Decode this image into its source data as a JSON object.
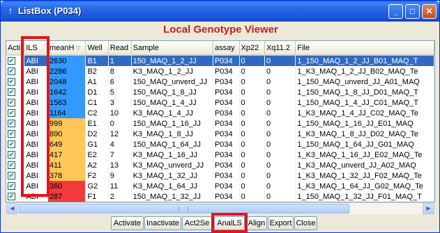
{
  "window": {
    "title": "ListBox (P034)",
    "controls": [
      "_",
      "□",
      "✕"
    ]
  },
  "header_text": "Local Genotype Viewer",
  "columns": [
    "Acti",
    "ILS",
    "meanH",
    "Well",
    "Read",
    "Sample",
    "assay",
    "Xp22",
    "Xq11.2",
    "File"
  ],
  "sort_indicator": "▽",
  "rows": [
    {
      "ils": "ABI",
      "meanH": "2630",
      "well": "B1",
      "read": "1",
      "sample": "150_MAQ_1_2_JJ",
      "assay": "P034",
      "xp22": "0",
      "xq": "0",
      "file": "1_150_MAQ_1_2_JJ_B01_MAQ_T",
      "color": "#3399FF",
      "checked": true,
      "selected": true
    },
    {
      "ils": "ABI",
      "meanH": "2286",
      "well": "B2",
      "read": "8",
      "sample": "K3_MAQ_1_2_JJ",
      "assay": "P034",
      "xp22": "0",
      "xq": "0",
      "file": "1_K3_MAQ_1_2_JJ_B02_MAQ_Te",
      "color": "#3399FF",
      "checked": true,
      "selected": false
    },
    {
      "ils": "ABI",
      "meanH": "2048",
      "well": "A1",
      "read": "6",
      "sample": "150_MAQ_unverd_JJ",
      "assay": "P034",
      "xp22": "0",
      "xq": "0",
      "file": "1_150_MAQ_unverd_JJ_A01_MAQ",
      "color": "#3399FF",
      "checked": true,
      "selected": false
    },
    {
      "ils": "ABI",
      "meanH": "1642",
      "well": "D1",
      "read": "5",
      "sample": "150_MAQ_1_8_JJ",
      "assay": "P034",
      "xp22": "0",
      "xq": "0",
      "file": "1_150_MAQ_1_8_JJ_D01_MAQ_T",
      "color": "#3399FF",
      "checked": true,
      "selected": false
    },
    {
      "ils": "ABI",
      "meanH": "1563",
      "well": "C1",
      "read": "3",
      "sample": "150_MAQ_1_4_JJ",
      "assay": "P034",
      "xp22": "0",
      "xq": "0",
      "file": "1_150_MAQ_1_4_JJ_C01_MAQ_T",
      "color": "#3399FF",
      "checked": true,
      "selected": false
    },
    {
      "ils": "ABI",
      "meanH": "1164",
      "well": "C2",
      "read": "10",
      "sample": "K3_MAQ_1_4_JJ",
      "assay": "P034",
      "xp22": "0",
      "xq": "0",
      "file": "1_K3_MAQ_1_4_JJ_C02_MAQ_Te",
      "color": "#3399FF",
      "checked": true,
      "selected": false
    },
    {
      "ils": "ABI",
      "meanH": "999",
      "well": "E1",
      "read": "0",
      "sample": "150_MAQ_1_16_JJ",
      "assay": "P034",
      "xp22": "0",
      "xq": "0",
      "file": "1_150_MAQ_1_16_JJ_E01_MAQ",
      "color": "#FFC65A",
      "checked": true,
      "selected": false
    },
    {
      "ils": "ABI",
      "meanH": "890",
      "well": "D2",
      "read": "12",
      "sample": "K3_MAQ_1_8_JJ",
      "assay": "P034",
      "xp22": "0",
      "xq": "0",
      "file": "1_K3_MAQ_1_8_JJ_D02_MAQ_Te",
      "color": "#FFC65A",
      "checked": true,
      "selected": false
    },
    {
      "ils": "ABI",
      "meanH": "649",
      "well": "G1",
      "read": "4",
      "sample": "150_MAQ_1_64_JJ",
      "assay": "P034",
      "xp22": "0",
      "xq": "0",
      "file": "1_150_MAQ_1_64_JJ_G01_MAQ",
      "color": "#FFC65A",
      "checked": true,
      "selected": false
    },
    {
      "ils": "ABI",
      "meanH": "417",
      "well": "E2",
      "read": "7",
      "sample": "K3_MAQ_1_16_JJ",
      "assay": "P034",
      "xp22": "0",
      "xq": "0",
      "file": "1_K3_MAQ_1_16_JJ_E02_MAQ_Te",
      "color": "#FFC65A",
      "checked": true,
      "selected": false
    },
    {
      "ils": "ABI",
      "meanH": "411",
      "well": "A2",
      "read": "13",
      "sample": "K3_MAQ_unverd_JJ",
      "assay": "P034",
      "xp22": "0",
      "xq": "0",
      "file": "1_K3_MAQ_unverd_JJ_A02_MAQ",
      "color": "#FFC65A",
      "checked": true,
      "selected": false
    },
    {
      "ils": "ABI",
      "meanH": "378",
      "well": "F2",
      "read": "9",
      "sample": "K3_MAQ_1_32_JJ",
      "assay": "P034",
      "xp22": "0",
      "xq": "0",
      "file": "1_K3_MAQ_1_32_JJ_F02_MAQ_Te",
      "color": "#FFC65A",
      "checked": true,
      "selected": false
    },
    {
      "ils": "ABI",
      "meanH": "360",
      "well": "G2",
      "read": "11",
      "sample": "K3_MAQ_1_64_JJ",
      "assay": "P034",
      "xp22": "0",
      "xq": "0",
      "file": "1_K3_MAQ_1_64_JJ_G02_MAQ_Te",
      "color": "#F23A3A",
      "checked": true,
      "selected": false
    },
    {
      "ils": "ABI",
      "meanH": "287",
      "well": "F1",
      "read": "2",
      "sample": "150_MAQ_1_32_JJ",
      "assay": "P034",
      "xp22": "0",
      "xq": "0",
      "file": "1_150_MAQ_1_32_JJ_F01_MAQ_T",
      "color": "#F23A3A",
      "checked": true,
      "selected": false
    }
  ],
  "buttons": [
    "Activate",
    "Inactivate",
    "Act2Se",
    "AnalLS",
    "Align",
    "Export",
    "Close"
  ],
  "highlight_color": "#E3141A"
}
